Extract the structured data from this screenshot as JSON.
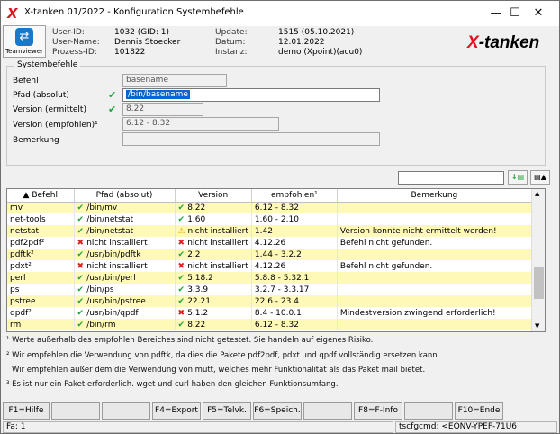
{
  "window": {
    "title": "X-tanken 01/2022 - Konfiguration Systembefehle",
    "minimize": "—",
    "maximize": "☐",
    "close": "✕"
  },
  "teamviewer": {
    "label": "Teamviewer"
  },
  "info": {
    "user_id_label": "User-ID:",
    "user_id": "1032 (GID: 1)",
    "user_name_label": "User-Name:",
    "user_name": "Dennis Stoecker",
    "process_label": "Prozess-ID:",
    "process": "101822",
    "update_label": "Update:",
    "update": "1515 (05.10.2021)",
    "date_label": "Datum:",
    "date": "12.01.2022",
    "instance_label": "Instanz:",
    "instance": "demo (Xpoint)(acu0)"
  },
  "brand": {
    "x": "X",
    "rest": "-tanken"
  },
  "form": {
    "group_title": "Systembefehle",
    "befehl_label": "Befehl",
    "befehl_value": "basename",
    "pfad_label": "Pfad (absolut)",
    "pfad_value": "/bin/basename",
    "version_label": "Version (ermittelt)",
    "version_value": "8.22",
    "empf_label": "Version (empfohlen)¹",
    "empf_value": "6.12 - 8.32",
    "bem_label": "Bemerkung",
    "bem_value": ""
  },
  "search": {
    "value": ""
  },
  "table": {
    "headers": [
      "Befehl",
      "Pfad (absolut)",
      "Version",
      "empfohlen¹",
      "Bemerkung"
    ],
    "rows": [
      {
        "befehl": "mv",
        "pfad_icon": "check",
        "pfad": "/bin/mv",
        "ver_icon": "check",
        "version": "8.22",
        "empf": "6.12 - 8.32",
        "bem": ""
      },
      {
        "befehl": "net-tools",
        "pfad_icon": "check",
        "pfad": "/bin/netstat",
        "ver_icon": "check",
        "version": "1.60",
        "empf": "1.60 - 2.10",
        "bem": ""
      },
      {
        "befehl": "netstat",
        "pfad_icon": "check",
        "pfad": "/bin/netstat",
        "ver_icon": "warn",
        "version": "nicht installiert",
        "empf": "1.42",
        "bem": "Version konnte nicht ermittelt werden!"
      },
      {
        "befehl": "pdf2pdf²",
        "pfad_icon": "cross",
        "pfad": "nicht installiert",
        "ver_icon": "cross",
        "version": "nicht installiert",
        "empf": "4.12.26",
        "bem": "Befehl nicht gefunden."
      },
      {
        "befehl": "pdftk²",
        "pfad_icon": "check",
        "pfad": "/usr/bin/pdftk",
        "ver_icon": "check",
        "version": "2.2",
        "empf": "1.44 - 3.2.2",
        "bem": ""
      },
      {
        "befehl": "pdxt²",
        "pfad_icon": "cross",
        "pfad": "nicht installiert",
        "ver_icon": "cross",
        "version": "nicht installiert",
        "empf": "4.12.26",
        "bem": "Befehl nicht gefunden."
      },
      {
        "befehl": "perl",
        "pfad_icon": "check",
        "pfad": "/usr/bin/perl",
        "ver_icon": "check",
        "version": "5.18.2",
        "empf": "5.8.8 - 5.32.1",
        "bem": ""
      },
      {
        "befehl": "ps",
        "pfad_icon": "check",
        "pfad": "/bin/ps",
        "ver_icon": "check",
        "version": "3.3.9",
        "empf": "3.2.7 - 3.3.17",
        "bem": ""
      },
      {
        "befehl": "pstree",
        "pfad_icon": "check",
        "pfad": "/usr/bin/pstree",
        "ver_icon": "check",
        "version": "22.21",
        "empf": "22.6 - 23.4",
        "bem": ""
      },
      {
        "befehl": "qpdf²",
        "pfad_icon": "check",
        "pfad": "/usr/bin/qpdf",
        "ver_icon": "cross",
        "version": "5.1.2",
        "empf": "8.4 - 10.0.1",
        "bem": "Mindestversion zwingend erforderlich!"
      },
      {
        "befehl": "rm",
        "pfad_icon": "check",
        "pfad": "/bin/rm",
        "ver_icon": "check",
        "version": "8.22",
        "empf": "6.12 - 8.32",
        "bem": ""
      }
    ]
  },
  "notes": [
    "¹ Werte außerhalb des empfohlen Bereiches sind nicht getestet. Sie handeln auf eigenes Risiko.",
    "² Wir empfehlen die Verwendung von pdftk, da dies die Pakete pdf2pdf, pdxt und qpdf vollständig ersetzen kann.",
    "Wir empfehlen außer dem die Verwendung von mutt, welches mehr Funktionalität als das Paket mail bietet.",
    "³ Es ist nur ein Paket erforderlich. wget und curl haben den gleichen Funktionsumfang."
  ],
  "fkeys": [
    "F1=Hilfe",
    "",
    "",
    "F4=Export",
    "F5=Telvk.",
    "F6=Speich.",
    "",
    "F8=F-Info",
    "",
    "F10=Ende"
  ],
  "status": {
    "left": "Fa: 1",
    "right": "tscfgcmd: <EQNV-YPEF-71U6"
  }
}
